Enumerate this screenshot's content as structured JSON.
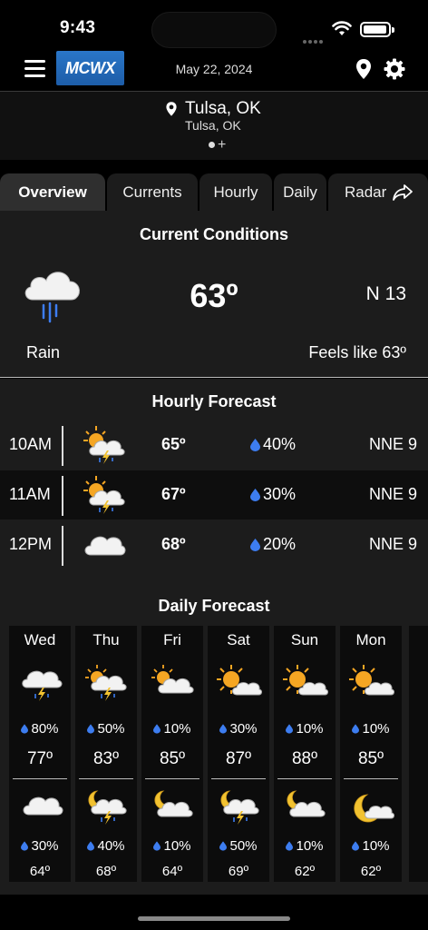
{
  "status": {
    "time": "9:43"
  },
  "header": {
    "logo": "MCWX",
    "date": "May 22, 2024"
  },
  "location": {
    "city": "Tulsa, OK",
    "subtitle": "Tulsa, OK",
    "add": "+"
  },
  "tabs": [
    {
      "label": "Overview",
      "active": true
    },
    {
      "label": "Currents"
    },
    {
      "label": "Hourly"
    },
    {
      "label": "Daily"
    },
    {
      "label": "Radar"
    }
  ],
  "current": {
    "title": "Current Conditions",
    "temp": "63º",
    "wind": "N 13",
    "condition": "Rain",
    "feels_like": "Feels like 63º",
    "icon": "rain-cloud-icon"
  },
  "hourly": {
    "title": "Hourly Forecast",
    "rows": [
      {
        "hour": "10AM",
        "temp": "65º",
        "precip": "40%",
        "wind": "NNE 9",
        "icon": "sun-cloud-storm-icon"
      },
      {
        "hour": "11AM",
        "temp": "67º",
        "precip": "30%",
        "wind": "NNE 9",
        "icon": "sun-cloud-storm-icon"
      },
      {
        "hour": "12PM",
        "temp": "68º",
        "precip": "20%",
        "wind": "NNE 9",
        "icon": "cloud-icon"
      }
    ]
  },
  "daily": {
    "title": "Daily Forecast",
    "days": [
      {
        "name": "Wed",
        "day_precip": "80%",
        "high": "77º",
        "night_precip": "30%",
        "low": "64º",
        "day_icon": "cloud-storm-icon",
        "night_icon": "cloud-icon"
      },
      {
        "name": "Thu",
        "day_precip": "50%",
        "high": "83º",
        "night_precip": "40%",
        "low": "68º",
        "day_icon": "sun-cloud-storm-icon",
        "night_icon": "moon-cloud-storm-icon"
      },
      {
        "name": "Fri",
        "day_precip": "10%",
        "high": "85º",
        "night_precip": "10%",
        "low": "64º",
        "day_icon": "partly-sunny-icon",
        "night_icon": "moon-cloud-icon"
      },
      {
        "name": "Sat",
        "day_precip": "30%",
        "high": "87º",
        "night_precip": "50%",
        "low": "69º",
        "day_icon": "sun-cloud-icon",
        "night_icon": "moon-cloud-storm-icon"
      },
      {
        "name": "Sun",
        "day_precip": "10%",
        "high": "88º",
        "night_precip": "10%",
        "low": "62º",
        "day_icon": "sun-cloud-icon",
        "night_icon": "moon-cloud-icon"
      },
      {
        "name": "Mon",
        "day_precip": "10%",
        "high": "85º",
        "night_precip": "10%",
        "low": "62º",
        "day_icon": "sun-cloud-icon",
        "night_icon": "moon-cloud-icon"
      }
    ]
  },
  "colors": {
    "accent": "#2a76c8",
    "drop": "#3d7df0",
    "sun": "#f5a623",
    "bolt": "#f2c230"
  }
}
